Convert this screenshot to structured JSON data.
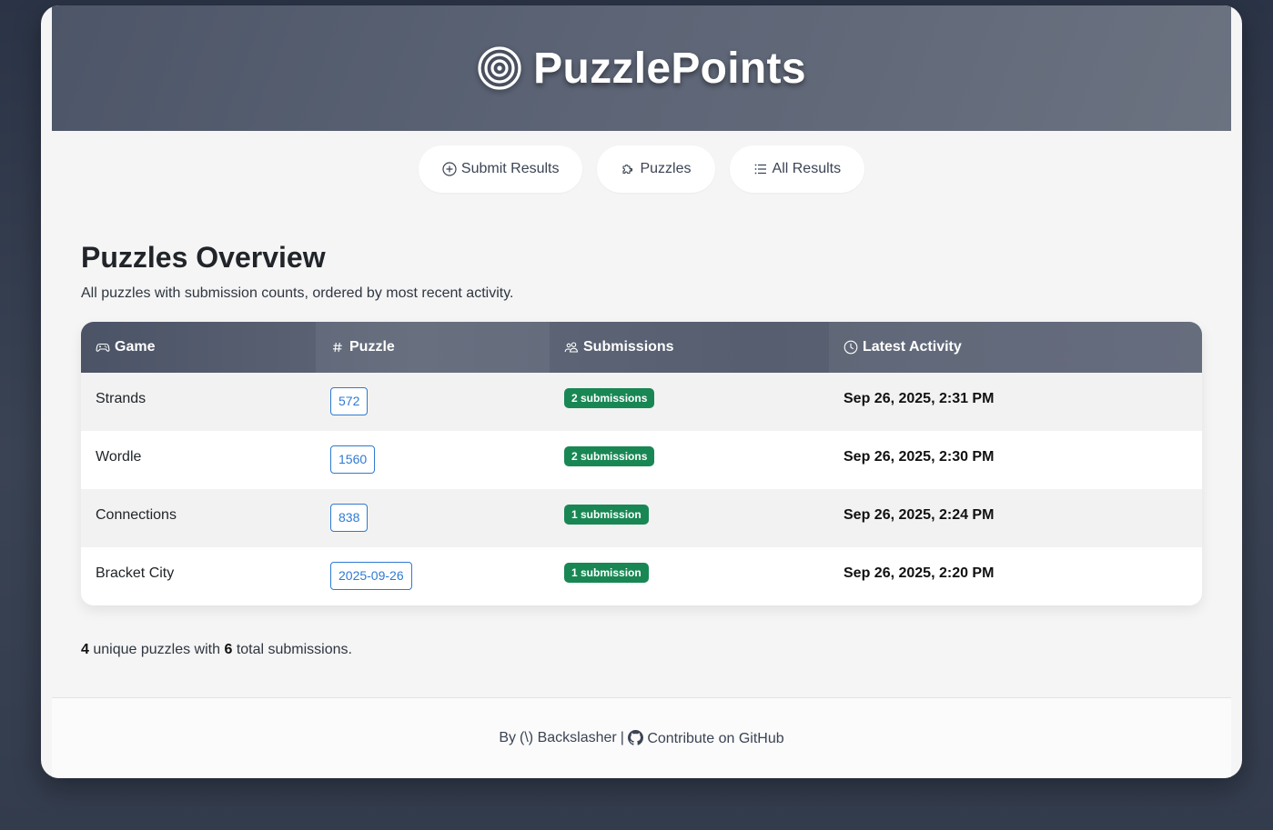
{
  "app": {
    "title": "PuzzlePoints",
    "logo_icon": "target-icon"
  },
  "nav": {
    "items": [
      {
        "label": "Submit Results",
        "icon": "plus-circle-icon"
      },
      {
        "label": "Puzzles",
        "icon": "puzzle-icon"
      },
      {
        "label": "All Results",
        "icon": "list-icon"
      }
    ]
  },
  "page": {
    "title": "Puzzles Overview",
    "subtitle": "All puzzles with submission counts, ordered by most recent activity."
  },
  "table": {
    "columns": [
      {
        "label": "Game",
        "icon": "controller-icon"
      },
      {
        "label": "Puzzle",
        "icon": "hash-icon"
      },
      {
        "label": "Submissions",
        "icon": "people-icon"
      },
      {
        "label": "Latest Activity",
        "icon": "clock-icon"
      }
    ],
    "rows": [
      {
        "game": "Strands",
        "puzzle": "572",
        "submissions": "2 submissions",
        "latest": "Sep 26, 2025, 2:31 PM"
      },
      {
        "game": "Wordle",
        "puzzle": "1560",
        "submissions": "2 submissions",
        "latest": "Sep 26, 2025, 2:30 PM"
      },
      {
        "game": "Connections",
        "puzzle": "838",
        "submissions": "1 submission",
        "latest": "Sep 26, 2025, 2:24 PM"
      },
      {
        "game": "Bracket City",
        "puzzle": "2025-09-26",
        "submissions": "1 submission",
        "latest": "Sep 26, 2025, 2:20 PM"
      }
    ]
  },
  "summary": {
    "unique_count": "4",
    "middle_text": "unique puzzles with",
    "total_count": "6",
    "end_text": "total submissions."
  },
  "footer": {
    "by_label": "By",
    "author": "(\\) Backslasher",
    "separator": "|",
    "github_label": "Contribute on GitHub",
    "github_icon": "github-icon"
  },
  "colors": {
    "badge_green": "#198754",
    "link_blue": "#2f7ad1",
    "header_slate": "#5d6576"
  }
}
